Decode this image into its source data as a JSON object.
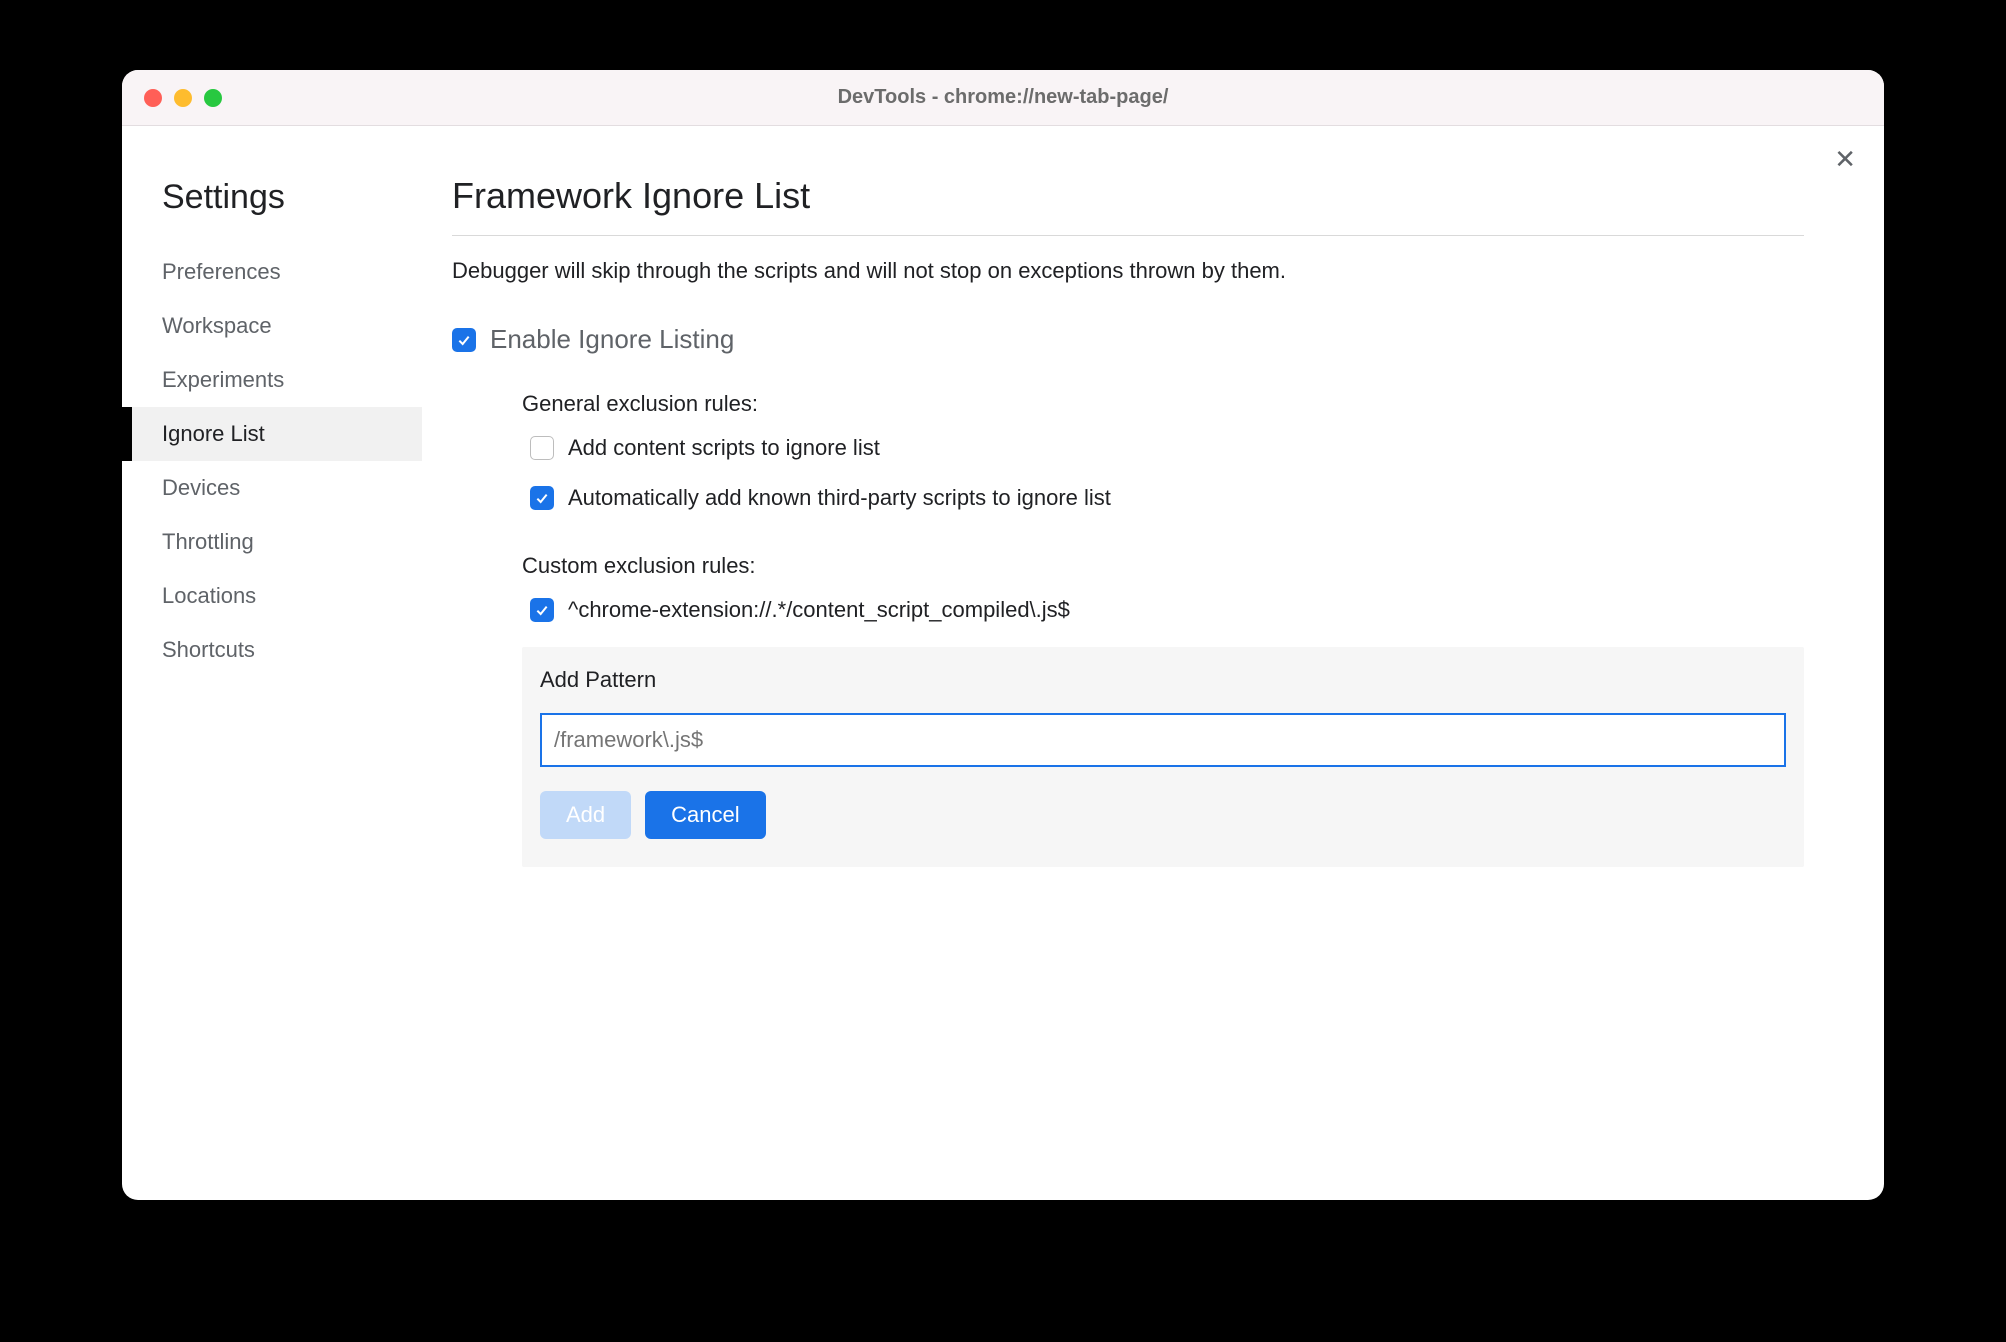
{
  "window": {
    "title": "DevTools - chrome://new-tab-page/"
  },
  "sidebar": {
    "title": "Settings",
    "items": [
      {
        "label": "Preferences",
        "active": false
      },
      {
        "label": "Workspace",
        "active": false
      },
      {
        "label": "Experiments",
        "active": false
      },
      {
        "label": "Ignore List",
        "active": true
      },
      {
        "label": "Devices",
        "active": false
      },
      {
        "label": "Throttling",
        "active": false
      },
      {
        "label": "Locations",
        "active": false
      },
      {
        "label": "Shortcuts",
        "active": false
      }
    ]
  },
  "main": {
    "title": "Framework Ignore List",
    "description": "Debugger will skip through the scripts and will not stop on exceptions thrown by them.",
    "enable": {
      "label": "Enable Ignore Listing",
      "checked": true
    },
    "general": {
      "title": "General exclusion rules:",
      "rules": [
        {
          "label": "Add content scripts to ignore list",
          "checked": false
        },
        {
          "label": "Automatically add known third-party scripts to ignore list",
          "checked": true
        }
      ]
    },
    "custom": {
      "title": "Custom exclusion rules:",
      "rules": [
        {
          "label": "^chrome-extension://.*/content_script_compiled\\.js$",
          "checked": true
        }
      ]
    },
    "addPattern": {
      "label": "Add Pattern",
      "placeholder": "/framework\\.js$",
      "add": "Add",
      "cancel": "Cancel"
    }
  }
}
